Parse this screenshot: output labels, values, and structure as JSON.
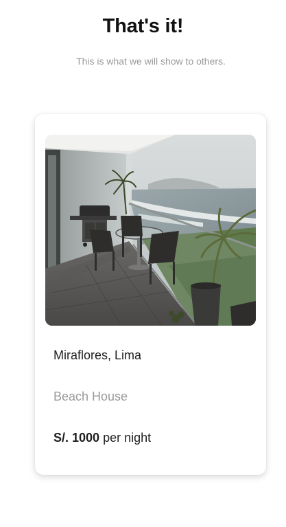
{
  "header": {
    "title": "That's it!",
    "subtitle": "This is what we will show to others."
  },
  "listing": {
    "photo_icon": "listing-photo",
    "location": "Miraflores, Lima",
    "property_type": "Beach House",
    "price_amount": "S/. 1000",
    "price_suffix": " per night"
  }
}
